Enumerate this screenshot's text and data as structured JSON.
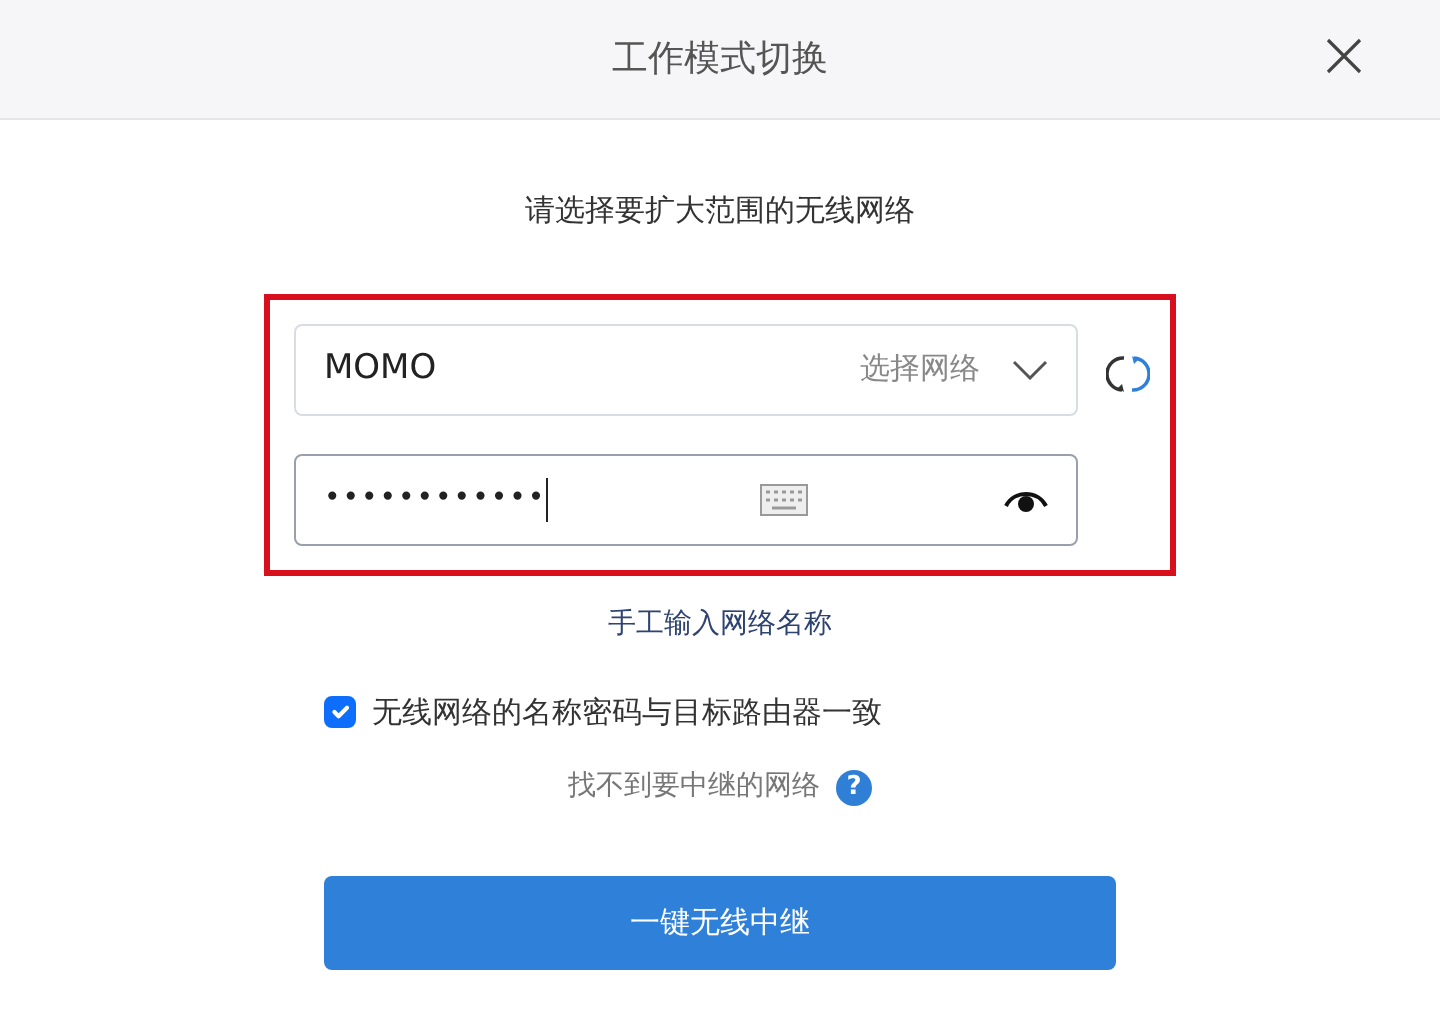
{
  "dialog": {
    "title": "工作模式切换"
  },
  "prompt": "请选择要扩大范围的无线网络",
  "highlighted": true,
  "network_select": {
    "value": "MOMO",
    "hint": "选择网络"
  },
  "password": {
    "value": "••••••••••••",
    "focused": true
  },
  "manual_link": "手工输入网络名称",
  "same_credentials": {
    "label": "无线网络的名称密码与目标路由器一致",
    "checked": true
  },
  "help_text": "找不到要中继的网络",
  "help_badge": "?",
  "submit_button": "一键无线中继"
}
